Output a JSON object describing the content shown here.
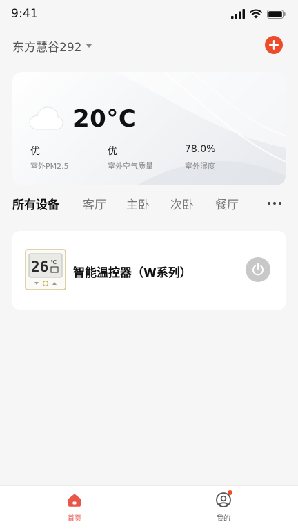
{
  "status_bar": {
    "time": "9:41"
  },
  "header": {
    "home_name": "东方慧谷292"
  },
  "weather": {
    "temperature": "20°C",
    "metrics": [
      {
        "value": "优",
        "label": "室外PM2.5"
      },
      {
        "value": "优",
        "label": "室外空气质量"
      },
      {
        "value": "78.0%",
        "label": "室外湿度"
      }
    ]
  },
  "tabs": [
    "所有设备",
    "客厅",
    "主卧",
    "次卧",
    "餐厅"
  ],
  "active_tab": "所有设备",
  "device": {
    "name": "智能温控器（W系列）",
    "display_digits": "26",
    "display_unit": "℃",
    "power_state": "off"
  },
  "bottom_nav": [
    {
      "label": "首页",
      "active": true
    },
    {
      "label": "我的",
      "active": false
    }
  ],
  "colors": {
    "accent": "#ee4b2b",
    "nav_active": "#e8564a",
    "power_off": "#c8c8c8",
    "background": "#f6f6f6"
  }
}
